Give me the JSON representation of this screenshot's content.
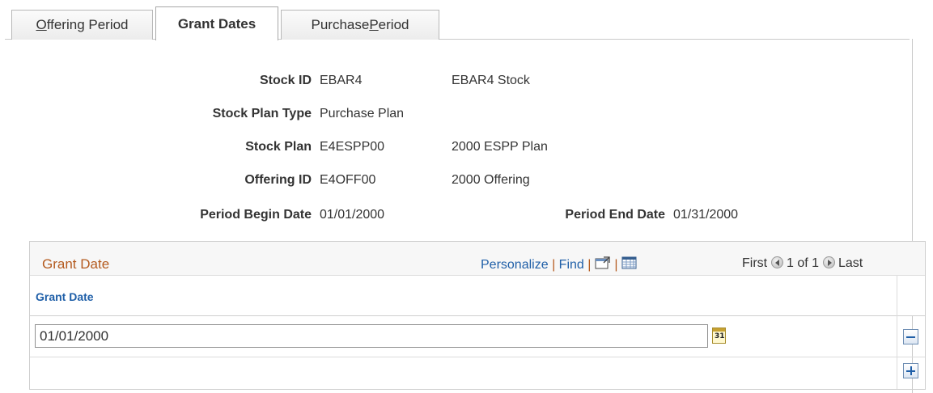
{
  "tabs": [
    {
      "pre": "",
      "ul": "O",
      "post": "ffering Period"
    },
    {
      "pre": "Grant Dates",
      "ul": "",
      "post": ""
    },
    {
      "pre": "Purchase ",
      "ul": "P",
      "post": "eriod"
    }
  ],
  "header": {
    "stock_id": {
      "label": "Stock ID",
      "value": "EBAR4",
      "desc": "EBAR4 Stock"
    },
    "stock_plan_type": {
      "label": "Stock Plan Type",
      "value": "Purchase Plan"
    },
    "stock_plan": {
      "label": "Stock Plan",
      "value": "E4ESPP00",
      "desc": "2000 ESPP Plan"
    },
    "offering_id": {
      "label": "Offering ID",
      "value": "E4OFF00",
      "desc": "2000 Offering"
    },
    "period_begin": {
      "label": "Period Begin Date",
      "value": "01/01/2000"
    },
    "period_end": {
      "label": "Period End Date",
      "value": "01/31/2000"
    }
  },
  "grid": {
    "title": "Grant Date",
    "personalize": "Personalize",
    "find": "Find",
    "sep": "|",
    "first": "First",
    "count": "1 of 1",
    "last": "Last",
    "column_header": "Grant Date",
    "rows": [
      {
        "grant_date": "01/01/2000"
      }
    ]
  },
  "icons": {
    "zoom": "view-all-icon",
    "download": "download-grid-icon",
    "calendar": "calendar-icon",
    "delete": "delete-row-icon",
    "add": "add-row-icon"
  },
  "colors": {
    "link": "#1f5fa8",
    "grid_title": "#b45a1e"
  }
}
